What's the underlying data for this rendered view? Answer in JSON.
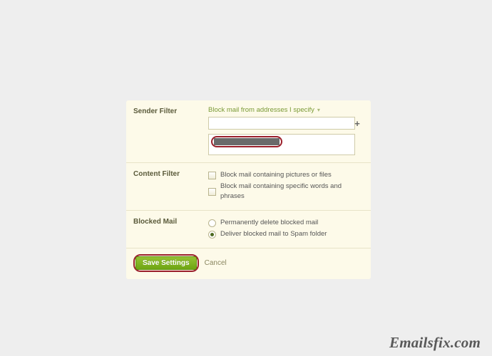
{
  "sender_filter": {
    "label": "Sender Filter",
    "mode_label": "Block mail from addresses I specify",
    "input_value": "",
    "redacted_entry": "[redacted]"
  },
  "content_filter": {
    "label": "Content Filter",
    "opt_pictures": "Block mail containing pictures or files",
    "opt_words": "Block mail containing specific words and phrases"
  },
  "blocked_mail": {
    "label": "Blocked Mail",
    "opt_delete": "Permanently delete blocked mail",
    "opt_spam": "Deliver blocked mail to Spam folder"
  },
  "footer": {
    "save": "Save Settings",
    "cancel": "Cancel"
  },
  "watermark": "Emailsfix.com"
}
